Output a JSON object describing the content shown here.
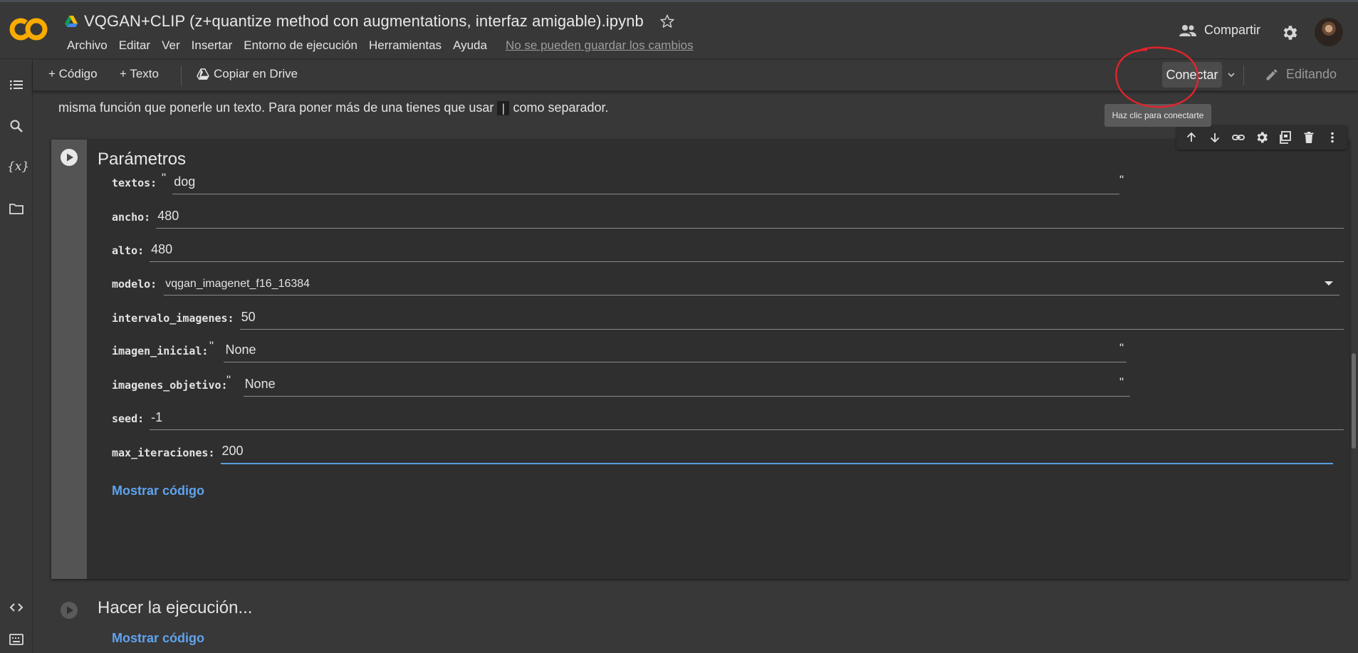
{
  "app": {
    "logo_text": "CO",
    "doc_title": "VQGAN+CLIP (z+quantize method con augmentations, interfaz amigable).ipynb",
    "menu": [
      "Archivo",
      "Editar",
      "Ver",
      "Insertar",
      "Entorno de ejecución",
      "Herramientas",
      "Ayuda"
    ],
    "save_note": "No se pueden guardar los cambios",
    "share_label": "Compartir"
  },
  "toolbar": {
    "code_label": "+ Código",
    "text_label": "+ Texto",
    "copy_drive_label": "Copiar en Drive",
    "connect_label": "Conectar",
    "editing_label": "Editando"
  },
  "tooltip": "Haz clic para conectarte",
  "text_cell": {
    "line_before": "misma función que ponerle un texto. Para poner más de una tienes que usar",
    "code": "|",
    "line_after": "como separador."
  },
  "form": {
    "title": "Parámetros",
    "fields": [
      {
        "label": "textos:",
        "value": "dog"
      },
      {
        "label": "ancho:",
        "value": "480"
      },
      {
        "label": "alto:",
        "value": "480"
      },
      {
        "label": "modelo:",
        "value": "vqgan_imagenet_f16_16384"
      },
      {
        "label": "intervalo_imagenes:",
        "value": "50"
      },
      {
        "label": "imagen_inicial:",
        "value": "None"
      },
      {
        "label": "imagenes_objetivo:",
        "value": "None"
      },
      {
        "label": "seed:",
        "value": "-1"
      },
      {
        "label": "max_iteraciones:",
        "value": "200"
      }
    ],
    "show_code": "Mostrar código"
  },
  "cell2": {
    "title": "Hacer la ejecución...",
    "show_code": "Mostrar código"
  },
  "colors": {
    "background": "#383838",
    "cell_background": "#2f2f2f",
    "link_blue": "#5fa3ee",
    "focus_blue": "#5c9ddf",
    "logo_orange": "#f9ab00",
    "annotation_red": "#e3232c"
  },
  "icons": {
    "header": [
      "drive-icon",
      "star-icon",
      "people-icon",
      "gear-icon"
    ],
    "rail": [
      "toc-icon",
      "search-icon",
      "variables-icon",
      "folder-icon",
      "code-snippets-icon",
      "terminal-icon"
    ],
    "cell_toolbar": [
      "arrow-up-icon",
      "arrow-down-icon",
      "link-icon",
      "gear-icon",
      "mirror-cell-icon",
      "trash-icon",
      "more-vert-icon"
    ]
  }
}
